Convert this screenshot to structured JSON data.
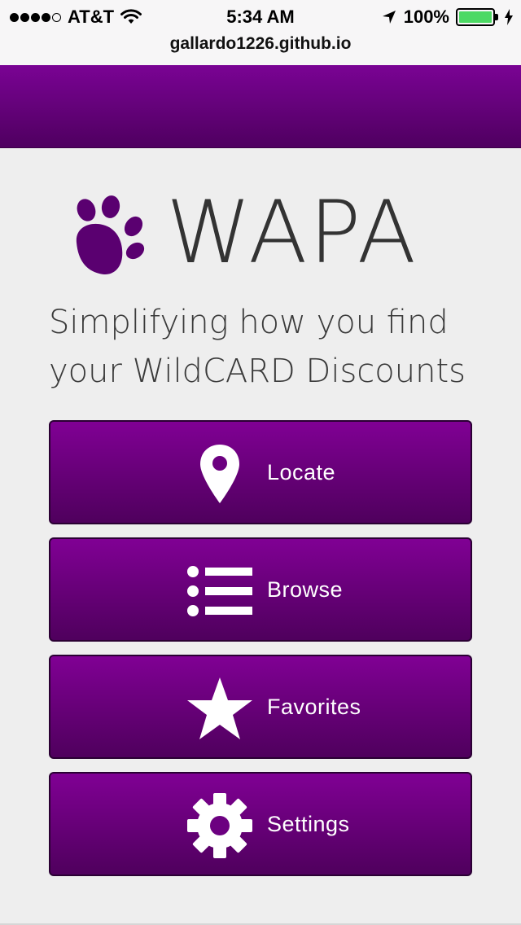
{
  "status_bar": {
    "carrier": "AT&T",
    "signal_bars_filled": 4,
    "signal_bars_total": 5,
    "time": "5:34 AM",
    "battery_percent": "100%",
    "battery_level": 1.0,
    "icons": [
      "wifi-icon",
      "location-arrow-icon",
      "battery-icon",
      "charging-bolt-icon"
    ]
  },
  "browser": {
    "url": "gallardo1226.github.io"
  },
  "colors": {
    "brand_purple": "#6a0080",
    "header_purple": "#62007a",
    "logo_purple": "#5a0070",
    "page_bg": "#eeeeee"
  },
  "brand": {
    "logo_icon": "paw-print-icon",
    "name": "WAPA",
    "tagline_line1": "Simplifying how you find",
    "tagline_line2": "your WildCARD Discounts"
  },
  "menu": [
    {
      "label": "Locate",
      "icon": "map-pin-icon"
    },
    {
      "label": "Browse",
      "icon": "list-icon"
    },
    {
      "label": "Favorites",
      "icon": "star-icon"
    },
    {
      "label": "Settings",
      "icon": "gear-icon"
    }
  ]
}
